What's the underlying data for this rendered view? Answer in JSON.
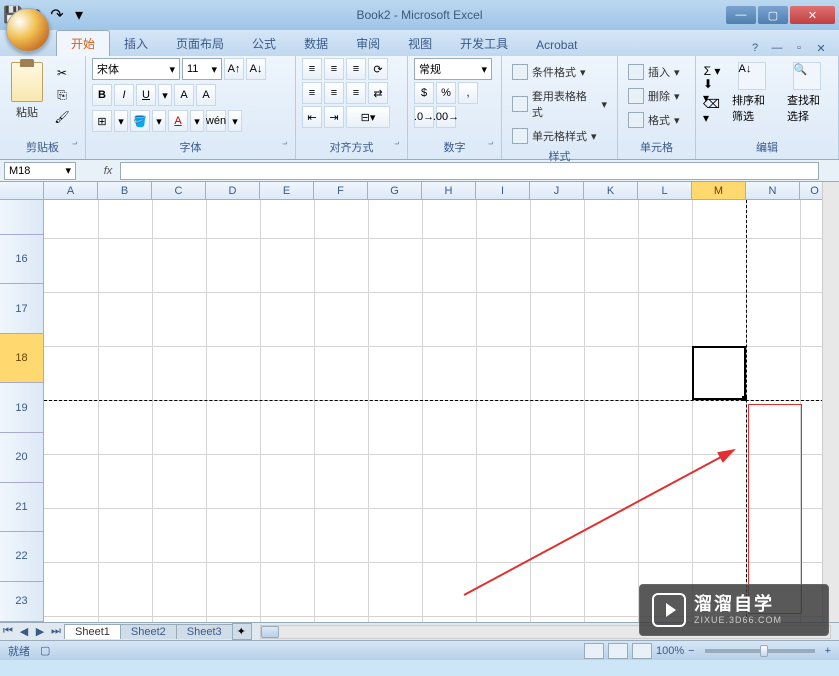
{
  "window": {
    "title": "Book2 - Microsoft Excel"
  },
  "tabs": {
    "home": "开始",
    "insert": "插入",
    "pageLayout": "页面布局",
    "formulas": "公式",
    "data": "数据",
    "review": "审阅",
    "view": "视图",
    "devTools": "开发工具",
    "acrobat": "Acrobat"
  },
  "ribbon": {
    "clipboard": {
      "label": "剪贴板",
      "paste": "粘贴"
    },
    "font": {
      "label": "字体",
      "name": "宋体",
      "size": "11"
    },
    "alignment": {
      "label": "对齐方式"
    },
    "number": {
      "label": "数字",
      "format": "常规"
    },
    "styles": {
      "label": "样式",
      "condFormat": "条件格式",
      "tableFormat": "套用表格格式",
      "cellStyles": "单元格样式"
    },
    "cells": {
      "label": "单元格",
      "insert": "插入",
      "delete": "删除",
      "format": "格式"
    },
    "editing": {
      "label": "编辑",
      "sort": "排序和筛选",
      "find": "查找和选择"
    }
  },
  "nameBox": {
    "value": "M18"
  },
  "columns": [
    "A",
    "B",
    "C",
    "D",
    "E",
    "F",
    "G",
    "H",
    "I",
    "J",
    "K",
    "L",
    "M",
    "N",
    "O"
  ],
  "rows": [
    "16",
    "17",
    "18",
    "19",
    "20",
    "21",
    "22",
    "23"
  ],
  "selectedCol": "M",
  "selectedRow": "18",
  "sheetTabs": {
    "s1": "Sheet1",
    "s2": "Sheet2",
    "s3": "Sheet3"
  },
  "status": {
    "ready": "就绪",
    "zoom": "100%"
  },
  "watermark": {
    "main": "溜溜自学",
    "sub": "ZIXUE.3D66.COM"
  }
}
